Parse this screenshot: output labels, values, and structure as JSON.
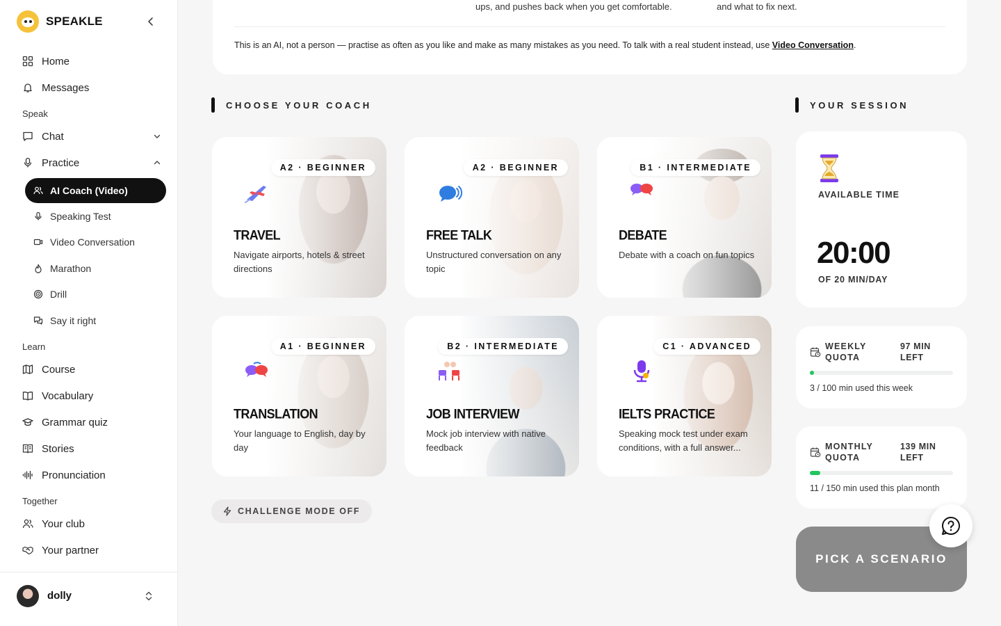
{
  "app": {
    "name": "SPEAKLE"
  },
  "sidebar": {
    "home": "Home",
    "messages": "Messages",
    "section_speak": "Speak",
    "chat": "Chat",
    "practice": "Practice",
    "practice_items": [
      "AI Coach (Video)",
      "Speaking Test",
      "Video Conversation",
      "Marathon",
      "Drill",
      "Say it right"
    ],
    "section_learn": "Learn",
    "learn_items": [
      "Course",
      "Vocabulary",
      "Grammar quiz",
      "Stories",
      "Pronunciation"
    ],
    "section_together": "Together",
    "together_items": [
      "Your club",
      "Your partner"
    ]
  },
  "user": {
    "name": "dolly"
  },
  "top": {
    "text_a": "ups, and pushes back when you get comfortable.",
    "text_b": "and what to fix next.",
    "disclaimer": "This is an AI, not a person — practise as often as you like and make as many mistakes as you need. To talk with a real student instead, use ",
    "disclaimer_link": "Video Conversation",
    "disclaimer_end": "."
  },
  "coach_heading": "CHOOSE YOUR COACH",
  "session_heading": "YOUR SESSION",
  "coaches": [
    {
      "level": "A2 · BEGINNER",
      "title": "TRAVEL",
      "desc": "Navigate airports, hotels & street directions",
      "icon": "airplane-icon"
    },
    {
      "level": "A2 · BEGINNER",
      "title": "FREE TALK",
      "desc": "Unstructured conversation on any topic",
      "icon": "speech-bubble-icon"
    },
    {
      "level": "B1 · INTERMEDIATE",
      "title": "DEBATE",
      "desc": "Debate with a coach on fun topics",
      "icon": "debate-bubbles-icon"
    },
    {
      "level": "A1 · BEGINNER",
      "title": "TRANSLATION",
      "desc": "Your language to English, day by day",
      "icon": "translation-bubbles-icon"
    },
    {
      "level": "B2 · INTERMEDIATE",
      "title": "JOB INTERVIEW",
      "desc": "Mock job interview with native feedback",
      "icon": "interview-chairs-icon"
    },
    {
      "level": "C1 · ADVANCED",
      "title": "IELTS PRACTICE",
      "desc": "Speaking mock test under exam conditions, with a full answer...",
      "icon": "microphone-icon"
    }
  ],
  "challenge_label": "CHALLENGE MODE OFF",
  "session": {
    "available_label": "AVAILABLE TIME",
    "time": "20:00",
    "of_label": "OF 20 MIN/DAY",
    "weekly": {
      "title": "WEEKLY QUOTA",
      "left": "97 MIN LEFT",
      "used": "3 / 100 min used this week",
      "fraction": 0.03
    },
    "monthly": {
      "title": "MONTHLY QUOTA",
      "left": "139 MIN LEFT",
      "used": "11 / 150 min used this plan month",
      "fraction": 0.0733
    }
  },
  "pick_button": "PICK A SCENARIO",
  "colors": {
    "accent": "#111111",
    "progress": "#22c55e",
    "pick_button_bg": "#8a8a8a"
  }
}
